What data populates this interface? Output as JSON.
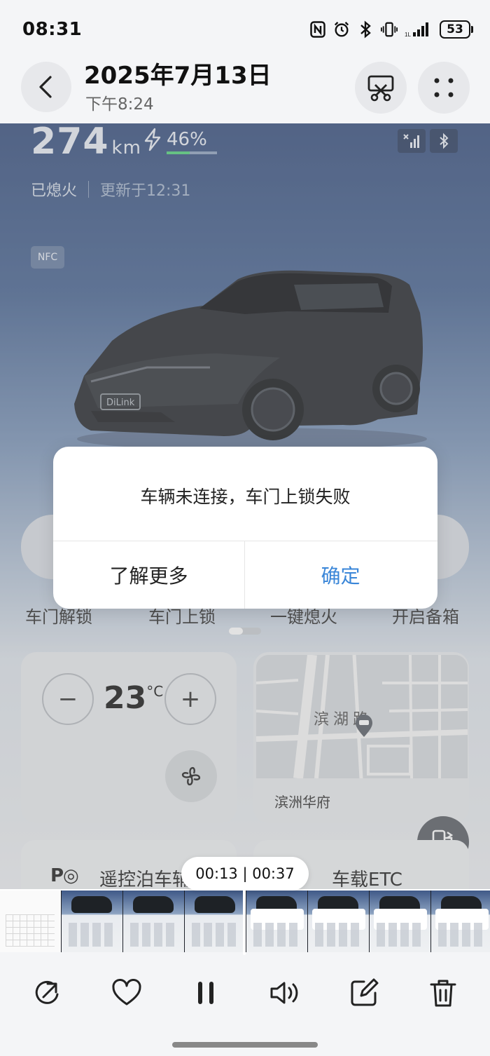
{
  "status_bar": {
    "time": "08:31",
    "battery_level": "53",
    "icons": [
      "nfc-icon",
      "alarm-icon",
      "bluetooth-icon",
      "vibrate-icon",
      "signal-icon"
    ]
  },
  "header": {
    "date": "2025年7月13日",
    "time": "下午8:24"
  },
  "vehicle": {
    "range_value": "274",
    "range_unit": "km",
    "charge_percent": "46%",
    "charge_level": 0.46,
    "engine_state": "已熄火",
    "updated": "更新于12:31",
    "nfc_label": "NFC",
    "car_badge": "DiLink"
  },
  "quick_actions": [
    "车门解锁",
    "车门上锁",
    "一键熄火",
    "开启备箱"
  ],
  "climate": {
    "temperature": "23",
    "unit": "°C",
    "minus": "−",
    "plus": "+"
  },
  "map": {
    "road_name": "滨湖路",
    "location": "滨洲华府"
  },
  "bottom_cards": {
    "parking": "遥控泊车辅",
    "parking_icon": "P◎",
    "etc": "车载ETC"
  },
  "dialog": {
    "message": "车辆未连接，车门上锁失败",
    "learn_more": "了解更多",
    "confirm": "确定"
  },
  "video": {
    "timestamp": "00:13 | 00:37",
    "progress": 0.35
  },
  "toolbar": {
    "items": [
      "share-icon",
      "heart-icon",
      "pause-icon",
      "volume-icon",
      "edit-icon",
      "trash-icon"
    ]
  },
  "colors": {
    "confirm_blue": "#3a86d8",
    "charge_green": "#54d17c"
  }
}
